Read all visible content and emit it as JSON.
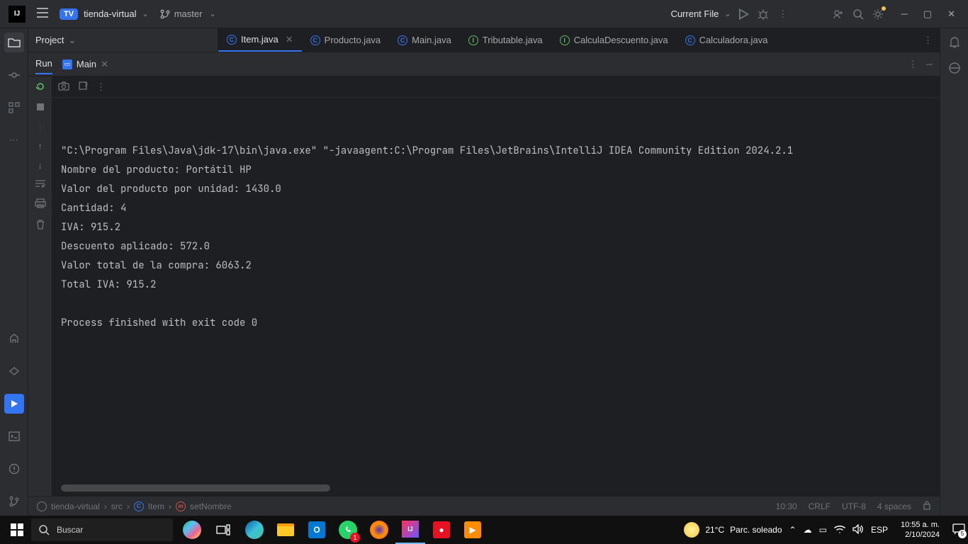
{
  "titlebar": {
    "project_badge": "TV",
    "project_name": "tienda-virtual",
    "branch": "master",
    "current_file_label": "Current File"
  },
  "project_panel": {
    "label": "Project"
  },
  "file_tabs": [
    {
      "icon": "c",
      "label": "Item.java",
      "active": true,
      "closable": true
    },
    {
      "icon": "c",
      "label": "Producto.java",
      "active": false,
      "closable": false
    },
    {
      "icon": "c",
      "label": "Main.java",
      "active": false,
      "closable": false
    },
    {
      "icon": "i",
      "label": "Tributable.java",
      "active": false,
      "closable": false
    },
    {
      "icon": "i",
      "label": "CalculaDescuento.java",
      "active": false,
      "closable": false
    },
    {
      "icon": "c",
      "label": "Calculadora.java",
      "active": false,
      "closable": false
    }
  ],
  "run": {
    "label": "Run",
    "tab_name": "Main",
    "console_lines": [
      "\"C:\\Program Files\\Java\\jdk-17\\bin\\java.exe\" \"-javaagent:C:\\Program Files\\JetBrains\\IntelliJ IDEA Community Edition 2024.2.1",
      "Nombre del producto: Portátil HP",
      "Valor del producto por unidad: 1430.0",
      "Cantidad: 4",
      "IVA: 915.2",
      "Descuento aplicado: 572.0",
      "Valor total de la compra: 6063.2",
      "Total IVA: 915.2",
      "",
      "Process finished with exit code 0"
    ]
  },
  "breadcrumb": {
    "project": "tienda-virtual",
    "folder": "src",
    "class": "Item",
    "method": "setNombre"
  },
  "status": {
    "cursor": "10:30",
    "lineending": "CRLF",
    "encoding": "UTF-8",
    "indent": "4 spaces"
  },
  "taskbar": {
    "search_placeholder": "Buscar",
    "weather_temp": "21°C",
    "weather_desc": "Parc. soleado",
    "lang": "ESP",
    "time": "10:55 a. m.",
    "date": "2/10/2024"
  }
}
